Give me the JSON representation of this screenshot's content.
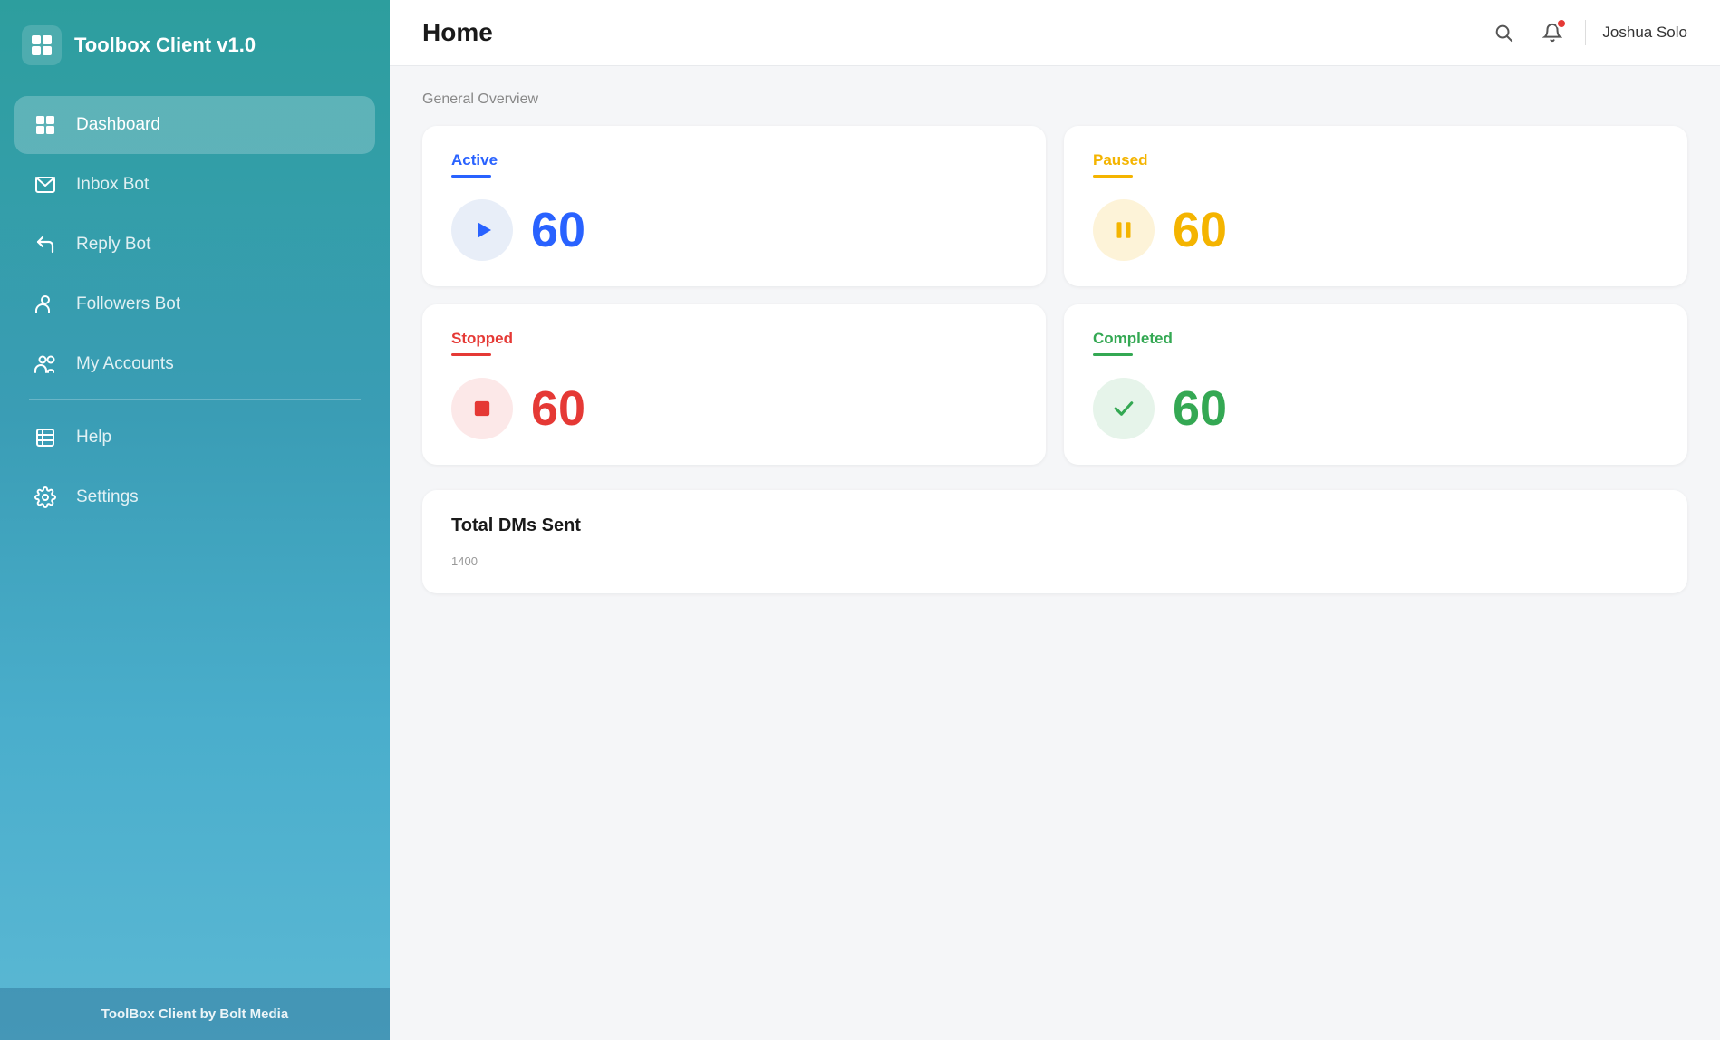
{
  "app": {
    "title": "Toolbox Client v1.0",
    "footer": "ToolBox Client by Bolt Media"
  },
  "sidebar": {
    "items": [
      {
        "id": "dashboard",
        "label": "Dashboard",
        "active": true
      },
      {
        "id": "inbox-bot",
        "label": "Inbox Bot",
        "active": false
      },
      {
        "id": "reply-bot",
        "label": "Reply Bot",
        "active": false
      },
      {
        "id": "followers-bot",
        "label": "Followers Bot",
        "active": false
      },
      {
        "id": "my-accounts",
        "label": "My Accounts",
        "active": false
      },
      {
        "id": "help",
        "label": "Help",
        "active": false
      },
      {
        "id": "settings",
        "label": "Settings",
        "active": false
      }
    ]
  },
  "header": {
    "page_title": "Home",
    "user_name": "Joshua Solo"
  },
  "overview": {
    "section_label": "General Overview",
    "cards": [
      {
        "id": "active",
        "label": "Active",
        "value": "60"
      },
      {
        "id": "paused",
        "label": "Paused",
        "value": "60"
      },
      {
        "id": "stopped",
        "label": "Stopped",
        "value": "60"
      },
      {
        "id": "completed",
        "label": "Completed",
        "value": "60"
      }
    ]
  },
  "dms": {
    "title": "Total DMs Sent",
    "chart_label": "1400"
  }
}
